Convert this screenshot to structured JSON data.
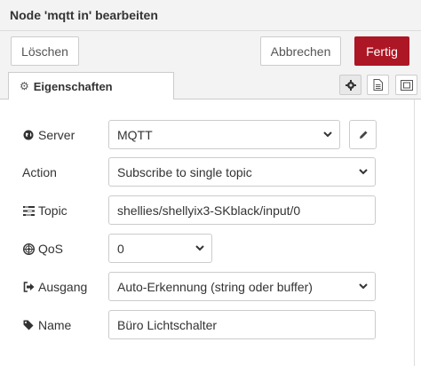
{
  "dialog": {
    "title": "Node 'mqtt in' bearbeiten",
    "delete_label": "Löschen",
    "cancel_label": "Abbrechen",
    "done_label": "Fertig"
  },
  "tabs": {
    "properties_label": "Eigenschaften",
    "icons": [
      "gear-icon",
      "description-icon",
      "appearance-icon"
    ]
  },
  "form": {
    "server": {
      "label": "Server",
      "value": "MQTT"
    },
    "action": {
      "label": "Action",
      "value": "Subscribe to single topic"
    },
    "topic": {
      "label": "Topic",
      "value": "shellies/shellyix3-SKblack/input/0"
    },
    "qos": {
      "label": "QoS",
      "value": "0"
    },
    "output": {
      "label": "Ausgang",
      "value": "Auto-Erkennung (string oder buffer)"
    },
    "name": {
      "label": "Name",
      "value": "Büro Lichtschalter"
    }
  },
  "colors": {
    "primary": "#ad1625",
    "border": "#cccccc",
    "background": "#f3f3f3"
  }
}
